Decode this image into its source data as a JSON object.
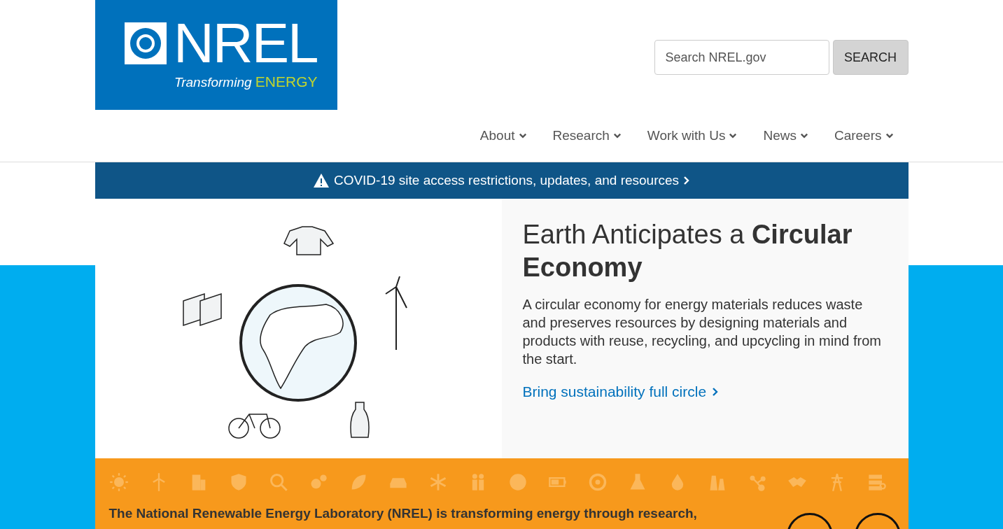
{
  "logo": {
    "name": "NREL",
    "tagline": "Transforming",
    "tagline_accent": "ENERGY"
  },
  "search": {
    "placeholder": "Search NREL.gov",
    "button": "SEARCH"
  },
  "nav": [
    "About",
    "Research",
    "Work with Us",
    "News",
    "Careers"
  ],
  "alert": {
    "text": "COVID-19 site access restrictions, updates, and resources"
  },
  "feature": {
    "title": "Earth Anticipates a **Circular Economy**",
    "body": "A circular economy for energy materials reduces waste and preserves resources by designing materials and products with reuse, recycling, and upcycling in mind from the start.",
    "link": "Bring sustainability full circle"
  },
  "mission": {
    "text": "The National Renewable Energy Laboratory (NREL) is transforming energy through research,"
  }
}
